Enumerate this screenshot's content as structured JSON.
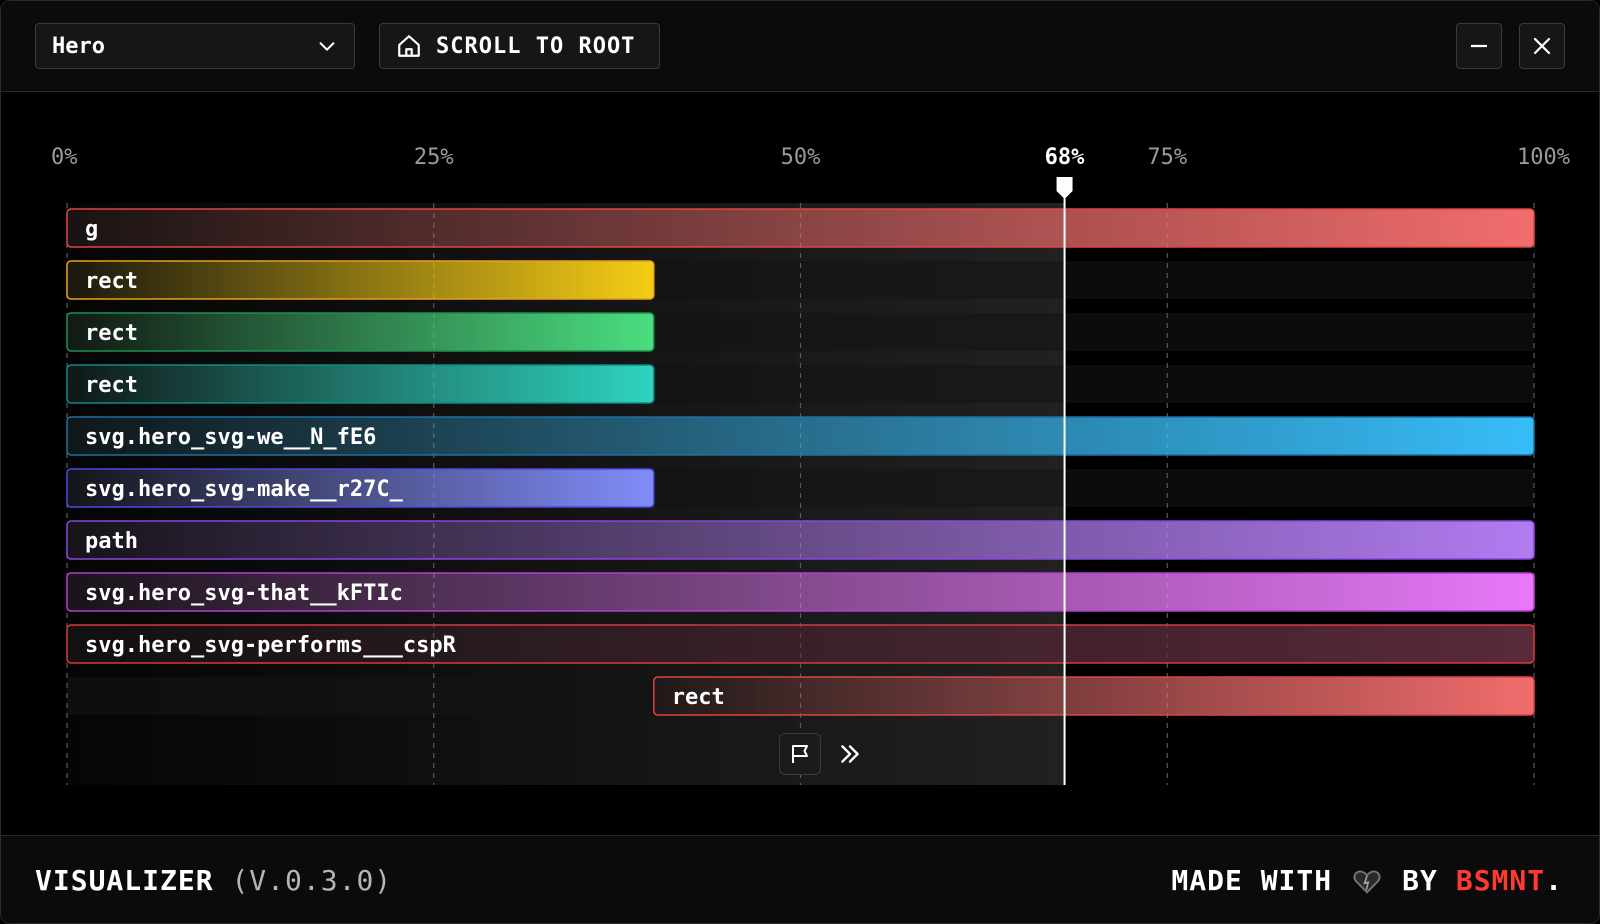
{
  "header": {
    "select_value": "Hero",
    "scroll_button_label": "SCROLL TO ROOT"
  },
  "footer": {
    "app_name": "VISUALIZER",
    "version": "(V.0.3.0)",
    "made_with": "MADE WITH",
    "by": "BY",
    "brand": "BSMNT",
    "brand_suffix": "."
  },
  "icons": {
    "select": "chevron-down-icon",
    "scroll": "home-icon",
    "minimize": "minimize-icon",
    "close": "close-icon",
    "flag": "flag-icon",
    "skip": "chevrons-right-icon",
    "heart": "heart-icon"
  },
  "colors": {
    "brand": "#ff3b2f",
    "playhead": "#ffffff"
  },
  "chart_data": {
    "type": "bar",
    "title": "",
    "axis_ticks": [
      "0%",
      "25%",
      "50%",
      "75%",
      "100%"
    ],
    "tick_values": [
      0,
      25,
      50,
      75,
      100
    ],
    "current_position": 68,
    "current_label": "68%",
    "xlim": [
      0,
      100
    ],
    "grid": true,
    "bars": [
      {
        "label": "g",
        "start": 0,
        "end": 100,
        "color": "#f26d6d",
        "border": "#e04444"
      },
      {
        "label": "rect",
        "start": 0,
        "end": 40,
        "color": "#f5cc14",
        "border": "#e8a21a"
      },
      {
        "label": "rect",
        "start": 0,
        "end": 40,
        "color": "#4ade80",
        "border": "#1f8f4e"
      },
      {
        "label": "rect",
        "start": 0,
        "end": 40,
        "color": "#2dd4bf",
        "border": "#138a7e"
      },
      {
        "label": "svg.hero_svg-we__N_fE6",
        "start": 0,
        "end": 100,
        "color": "#38bdf8",
        "border": "#1e6fa0"
      },
      {
        "label": "svg.hero_svg-make__r27C_",
        "start": 0,
        "end": 40,
        "color": "#818cf8",
        "border": "#4f46e5"
      },
      {
        "label": "path",
        "start": 0,
        "end": 100,
        "color": "#b07cf0",
        "border": "#8b45e0"
      },
      {
        "label": "svg.hero_svg-that__kFTIc",
        "start": 0,
        "end": 100,
        "color": "#e879f9",
        "border": "#b13fd0"
      },
      {
        "label": "svg.hero_svg-performs___cspR",
        "start": 0,
        "end": 100,
        "color": "#5a2a3a",
        "border": "#d63a3a"
      },
      {
        "label": "rect",
        "start": 40,
        "end": 100,
        "color": "#f26d6d",
        "border": "#e04444"
      }
    ]
  }
}
